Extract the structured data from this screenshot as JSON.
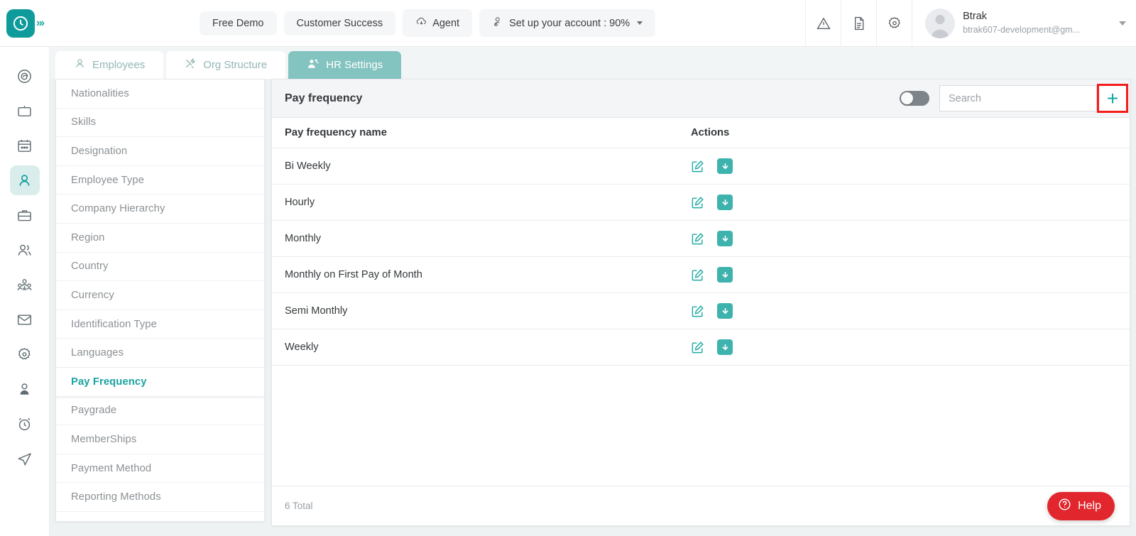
{
  "header": {
    "logo_icon": "clock-logo-icon",
    "expand_icon_label": "»›",
    "buttons": [
      {
        "label": "Free Demo",
        "icon": null
      },
      {
        "label": "Customer Success",
        "icon": null
      },
      {
        "label": "Agent",
        "icon": "cloud-download-icon"
      }
    ],
    "account_setup": {
      "label": "Set up your account : 90%",
      "icon": "user-settings-icon"
    },
    "icons": [
      "warning-triangle-icon",
      "document-icon",
      "gear-icon"
    ],
    "user": {
      "name": "Btrak",
      "email": "btrak607-development@gm...",
      "avatar_icon": "avatar-icon"
    }
  },
  "rail": {
    "items": [
      {
        "icon": "spiral-dashboard-icon",
        "active": false
      },
      {
        "icon": "tv-screen-icon",
        "active": false
      },
      {
        "icon": "calendar-icon",
        "active": false
      },
      {
        "icon": "person-icon",
        "active": true
      },
      {
        "icon": "briefcase-icon",
        "active": false
      },
      {
        "icon": "two-users-icon",
        "active": false
      },
      {
        "icon": "group-people-icon",
        "active": false
      },
      {
        "icon": "mail-envelope-icon",
        "active": false
      },
      {
        "icon": "gear-settings-icon",
        "active": false
      },
      {
        "icon": "user-profile-icon",
        "active": false
      },
      {
        "icon": "alarm-clock-icon",
        "active": false
      },
      {
        "icon": "send-paper-plane-icon",
        "active": false
      }
    ]
  },
  "tabs": [
    {
      "label": "Employees",
      "icon": "person-icon",
      "active": false
    },
    {
      "label": "Org Structure",
      "icon": "tools-icon",
      "active": false
    },
    {
      "label": "HR Settings",
      "icon": "people-gear-icon",
      "active": true
    }
  ],
  "settings_menu": {
    "items": [
      {
        "label": "Nationalities",
        "active": false
      },
      {
        "label": "Skills",
        "active": false
      },
      {
        "label": "Designation",
        "active": false
      },
      {
        "label": "Employee Type",
        "active": false
      },
      {
        "label": "Company Hierarchy",
        "active": false
      },
      {
        "label": "Region",
        "active": false
      },
      {
        "label": "Country",
        "active": false
      },
      {
        "label": "Currency",
        "active": false
      },
      {
        "label": "Identification Type",
        "active": false
      },
      {
        "label": "Languages",
        "active": false
      },
      {
        "label": "Pay Frequency",
        "active": true
      },
      {
        "label": "Paygrade",
        "active": false
      },
      {
        "label": "MemberShips",
        "active": false
      },
      {
        "label": "Payment Method",
        "active": false
      },
      {
        "label": "Reporting Methods",
        "active": false
      }
    ]
  },
  "panel": {
    "title": "Pay frequency",
    "toggle_state": "off",
    "search_placeholder": "Search",
    "search_value": "",
    "add_button_label": "+",
    "add_button_highlight_color": "#f41c1c",
    "columns": [
      "Pay frequency name",
      "Actions"
    ],
    "rows": [
      {
        "name": "Bi Weekly",
        "actions": [
          "edit-icon",
          "download-icon"
        ]
      },
      {
        "name": "Hourly",
        "actions": [
          "edit-icon",
          "download-icon"
        ]
      },
      {
        "name": "Monthly",
        "actions": [
          "edit-icon",
          "download-icon"
        ]
      },
      {
        "name": "Monthly on First Pay of Month",
        "actions": [
          "edit-icon",
          "download-icon"
        ]
      },
      {
        "name": "Semi Monthly",
        "actions": [
          "edit-icon",
          "download-icon"
        ]
      },
      {
        "name": "Weekly",
        "actions": [
          "edit-icon",
          "download-icon"
        ]
      }
    ],
    "footer_total": "6 Total"
  },
  "help": {
    "label": "Help",
    "icon": "question-circle-icon",
    "color": "#e1262d"
  },
  "colors": {
    "brand_teal": "#0f9b9b",
    "active_tab_teal": "#83c3c0",
    "action_teal": "#3eb3ad",
    "help_red": "#e1262d",
    "highlight_red": "#f41c1c"
  }
}
